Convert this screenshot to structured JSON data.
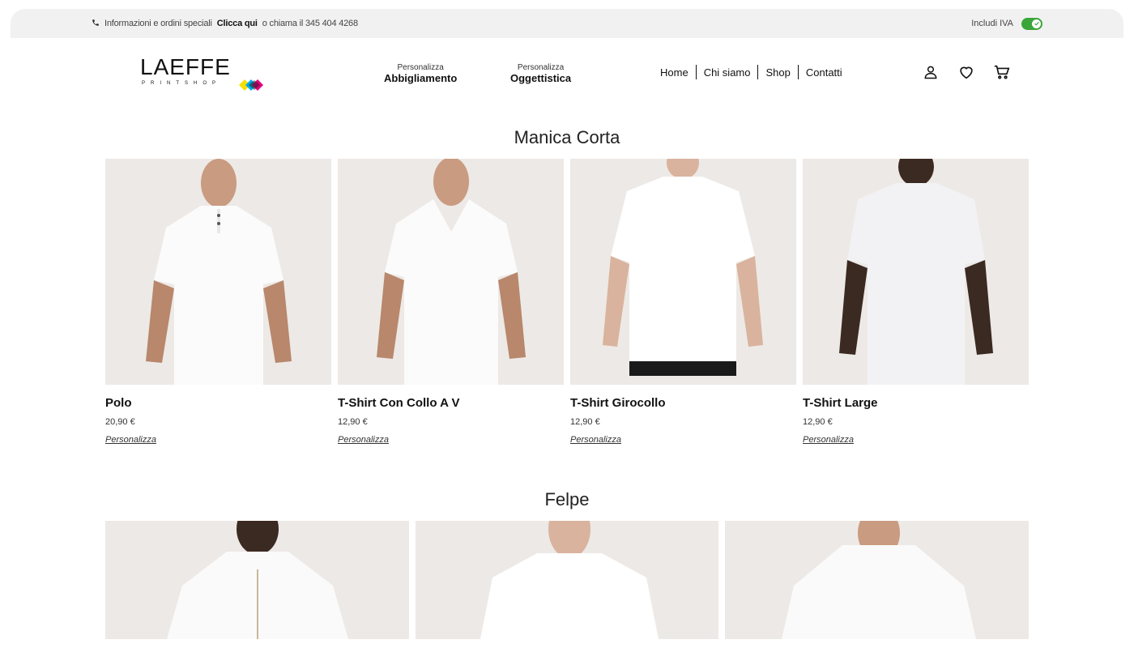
{
  "topbar": {
    "phone_icon": "phone-icon",
    "info_text": "Informazioni e ordini speciali",
    "cta_text": "Clicca qui",
    "call_text": "o chiama il 345 404 4268",
    "vat_label": "Includi IVA",
    "vat_enabled": true,
    "accent": "#3aa63a"
  },
  "logo": {
    "title": "LAEFFE",
    "subtitle": "PRINTSHOP"
  },
  "categories": [
    {
      "small": "Personalizza",
      "big": "Abbigliamento"
    },
    {
      "small": "Personalizza",
      "big": "Oggettistica"
    }
  ],
  "nav": [
    {
      "label": "Home"
    },
    {
      "label": "Chi siamo"
    },
    {
      "label": "Shop"
    },
    {
      "label": "Contatti"
    }
  ],
  "icons": [
    "user-icon",
    "heart-icon",
    "cart-icon"
  ],
  "sections": {
    "short_sleeve": {
      "title": "Manica Corta",
      "products": [
        {
          "name": "Polo",
          "price": "20,90 €",
          "action": "Personalizza"
        },
        {
          "name": "T-Shirt Con Collo A V",
          "price": "12,90 €",
          "action": "Personalizza"
        },
        {
          "name": "T-Shirt Girocollo",
          "price": "12,90 €",
          "action": "Personalizza"
        },
        {
          "name": "T-Shirt Large",
          "price": "12,90 €",
          "action": "Personalizza"
        }
      ]
    },
    "hoodies": {
      "title": "Felpe"
    }
  }
}
